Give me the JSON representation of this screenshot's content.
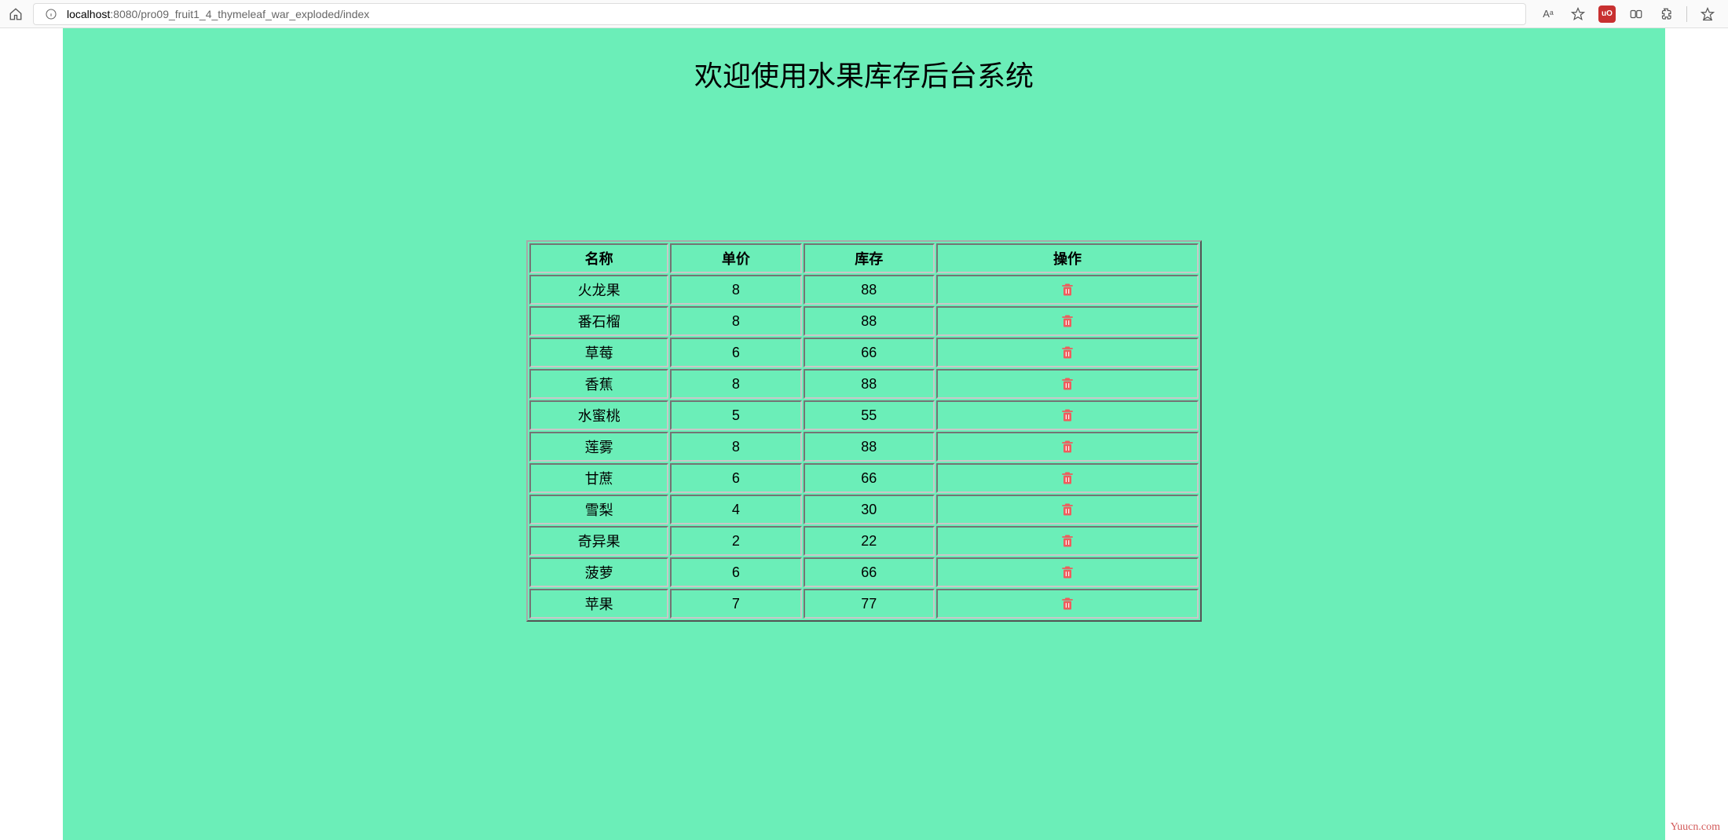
{
  "browser": {
    "url_host": "localhost",
    "url_port": ":8080",
    "url_path": "/pro09_fruit1_4_thymeleaf_war_exploded/index",
    "read_aloud": "Aᵃ",
    "ublock_label": "uO"
  },
  "page": {
    "title": "欢迎使用水果库存后台系统",
    "watermark": "Yuucn.com"
  },
  "table": {
    "headers": {
      "name": "名称",
      "price": "单价",
      "stock": "库存",
      "action": "操作"
    },
    "rows": [
      {
        "name": "火龙果",
        "price": "8",
        "stock": "88"
      },
      {
        "name": "番石榴",
        "price": "8",
        "stock": "88"
      },
      {
        "name": "草莓",
        "price": "6",
        "stock": "66"
      },
      {
        "name": "香蕉",
        "price": "8",
        "stock": "88"
      },
      {
        "name": "水蜜桃",
        "price": "5",
        "stock": "55"
      },
      {
        "name": "莲雾",
        "price": "8",
        "stock": "88"
      },
      {
        "name": "甘蔗",
        "price": "6",
        "stock": "66"
      },
      {
        "name": "雪梨",
        "price": "4",
        "stock": "30"
      },
      {
        "name": "奇异果",
        "price": "2",
        "stock": "22"
      },
      {
        "name": "菠萝",
        "price": "6",
        "stock": "66"
      },
      {
        "name": "苹果",
        "price": "7",
        "stock": "77"
      }
    ]
  }
}
